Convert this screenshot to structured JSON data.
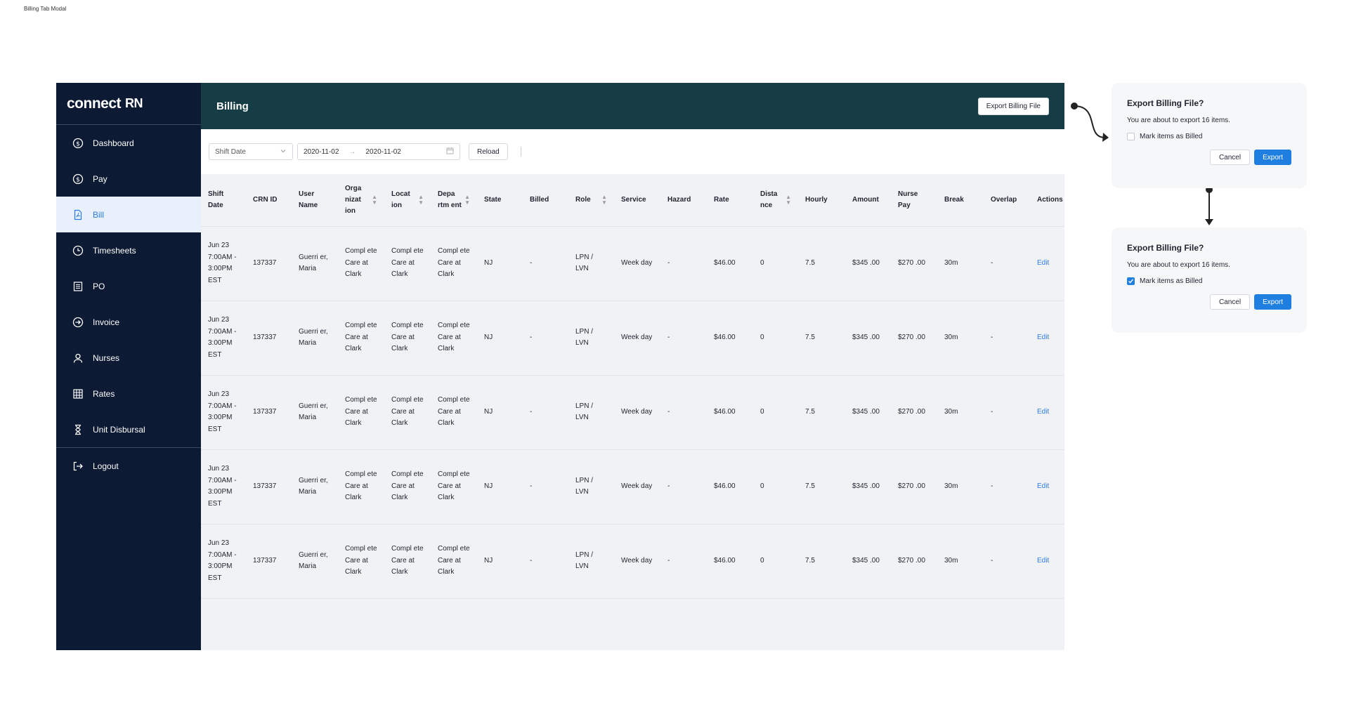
{
  "canvas_title": "Billing Tab Modal",
  "logo": {
    "brand": "connect",
    "suffix": "RN"
  },
  "nav": [
    {
      "label": "Dashboard",
      "icon": "dollar-circle-icon"
    },
    {
      "label": "Pay",
      "icon": "dollar-circle-icon"
    },
    {
      "label": "Bill",
      "icon": "pdf-file-icon",
      "active": true
    },
    {
      "label": "Timesheets",
      "icon": "clock-icon"
    },
    {
      "label": "PO",
      "icon": "list-document-icon"
    },
    {
      "label": "Invoice",
      "icon": "arrow-circle-icon"
    },
    {
      "label": "Nurses",
      "icon": "person-icon"
    },
    {
      "label": "Rates",
      "icon": "grid-icon"
    },
    {
      "label": "Unit Disbursal",
      "icon": "hourglass-icon"
    }
  ],
  "logout_label": "Logout",
  "header": {
    "title": "Billing",
    "export_button": "Export Billing File"
  },
  "filters": {
    "shift_select": "Shift Date",
    "date_from": "2020-11-02",
    "date_to": "2020-11-02",
    "reload": "Reload"
  },
  "table": {
    "columns": [
      {
        "label": "Shift Date",
        "sortable": false
      },
      {
        "label": "CRN ID",
        "sortable": false
      },
      {
        "label": "User Name",
        "sortable": false
      },
      {
        "label": "Orga nizat ion",
        "sortable": true
      },
      {
        "label": "Locat ion",
        "sortable": true
      },
      {
        "label": "Depa rtm ent",
        "sortable": true
      },
      {
        "label": "State",
        "sortable": false
      },
      {
        "label": "Billed",
        "sortable": false
      },
      {
        "label": "Role",
        "sortable": true
      },
      {
        "label": "Service",
        "sortable": false
      },
      {
        "label": "Hazard",
        "sortable": false
      },
      {
        "label": "Rate",
        "sortable": false
      },
      {
        "label": "Dista nce",
        "sortable": true
      },
      {
        "label": "Hourly",
        "sortable": false
      },
      {
        "label": "Amount",
        "sortable": false
      },
      {
        "label": "Nurse Pay",
        "sortable": false
      },
      {
        "label": "Break",
        "sortable": false
      },
      {
        "label": "Overlap",
        "sortable": false
      },
      {
        "label": "Actions",
        "sortable": false
      }
    ],
    "rows": [
      [
        "Jun 23 7:00AM - 3:00PM EST",
        "137337",
        "Guerri er, Maria",
        "Compl ete Care at Clark",
        "Compl ete Care at Clark",
        "Compl ete Care at Clark",
        "NJ",
        "-",
        "LPN / LVN",
        "Week day",
        "-",
        "$46.00",
        "0",
        "7.5",
        "$345 .00",
        "$270 .00",
        "30m",
        "-",
        "Edit"
      ],
      [
        "Jun 23 7:00AM - 3:00PM EST",
        "137337",
        "Guerri er, Maria",
        "Compl ete Care at Clark",
        "Compl ete Care at Clark",
        "Compl ete Care at Clark",
        "NJ",
        "-",
        "LPN / LVN",
        "Week day",
        "-",
        "$46.00",
        "0",
        "7.5",
        "$345 .00",
        "$270 .00",
        "30m",
        "-",
        "Edit"
      ],
      [
        "Jun 23 7:00AM - 3:00PM EST",
        "137337",
        "Guerri er, Maria",
        "Compl ete Care at Clark",
        "Compl ete Care at Clark",
        "Compl ete Care at Clark",
        "NJ",
        "-",
        "LPN / LVN",
        "Week day",
        "-",
        "$46.00",
        "0",
        "7.5",
        "$345 .00",
        "$270 .00",
        "30m",
        "-",
        "Edit"
      ],
      [
        "Jun 23 7:00AM - 3:00PM EST",
        "137337",
        "Guerri er, Maria",
        "Compl ete Care at Clark",
        "Compl ete Care at Clark",
        "Compl ete Care at Clark",
        "NJ",
        "-",
        "LPN / LVN",
        "Week day",
        "-",
        "$46.00",
        "0",
        "7.5",
        "$345 .00",
        "$270 .00",
        "30m",
        "-",
        "Edit"
      ],
      [
        "Jun 23 7:00AM - 3:00PM EST",
        "137337",
        "Guerri er, Maria",
        "Compl ete Care at Clark",
        "Compl ete Care at Clark",
        "Compl ete Care at Clark",
        "NJ",
        "-",
        "LPN / LVN",
        "Week day",
        "-",
        "$46.00",
        "0",
        "7.5",
        "$345 .00",
        "$270 .00",
        "30m",
        "-",
        "Edit"
      ]
    ]
  },
  "modals": [
    {
      "title": "Export Billing File?",
      "message": "You are about to export 16 items.",
      "checkbox_label": "Mark items as Billed",
      "checked": false,
      "cancel": "Cancel",
      "confirm": "Export"
    },
    {
      "title": "Export Billing File?",
      "message": "You are about to export 16 items.",
      "checkbox_label": "Mark items as Billed",
      "checked": true,
      "cancel": "Cancel",
      "confirm": "Export"
    }
  ],
  "colors": {
    "sidebar": "#0c1a33",
    "header": "#163d45",
    "accent": "#2c7be5",
    "primary_button": "#1f7fe0",
    "table_bg": "#f1f2f5"
  }
}
